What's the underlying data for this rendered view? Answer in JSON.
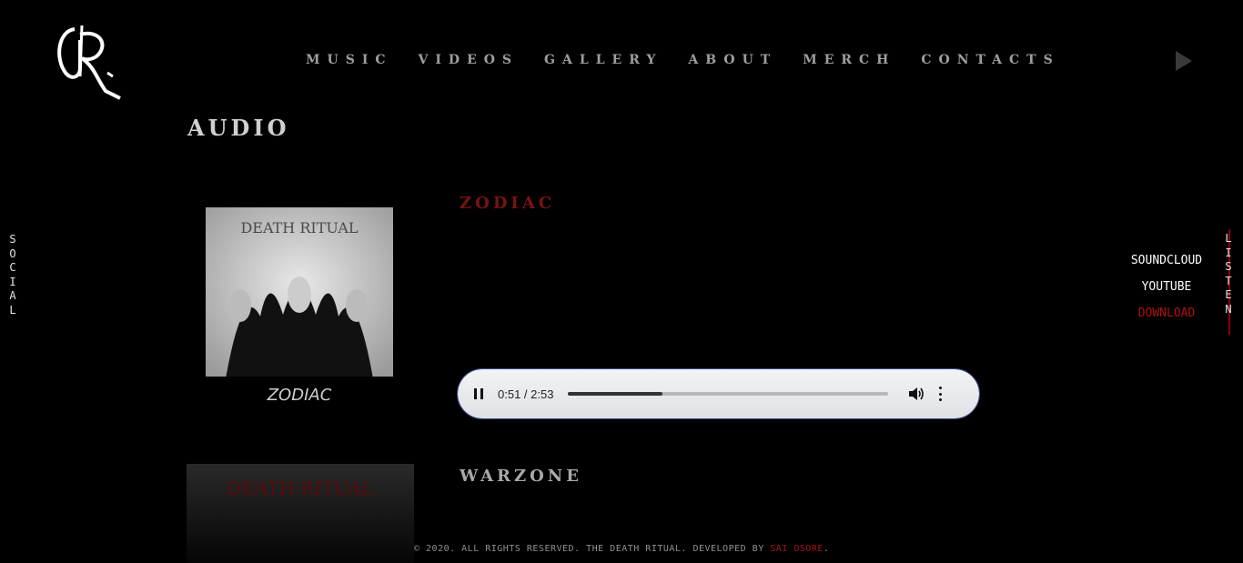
{
  "nav": {
    "items": [
      "MUSIC",
      "VIDEOS",
      "GALLERY",
      "ABOUT",
      "MERCH",
      "CONTACTS"
    ]
  },
  "section": {
    "title": "AUDIO"
  },
  "tracks": [
    {
      "title": "ZODIAC",
      "cover_caption": "ZODIAC",
      "cover_band_text": "DEATH RITUAL"
    },
    {
      "title": "WARZONE",
      "cover_band_text": "DEATH RITUAL"
    }
  ],
  "player": {
    "time": "0:51 / 2:53",
    "progress": 0.295
  },
  "side": {
    "social": "SOCIAL",
    "listen": "LISTEN"
  },
  "listen_links": [
    {
      "label": "SOUNDCLOUD",
      "color": "#ffffff"
    },
    {
      "label": "YOUTUBE",
      "color": "#ffffff"
    },
    {
      "label": "DOWNLOAD",
      "color": "#b01010"
    }
  ],
  "footer": {
    "text": "© 2020. ALL RIGHTS RESERVED. THE DEATH RITUAL. DEVELOPED BY ",
    "developer": "SAI OSORE",
    "end": "."
  },
  "colors": {
    "accent_red": "#8b0000",
    "text_gray": "#9e9e9e"
  }
}
